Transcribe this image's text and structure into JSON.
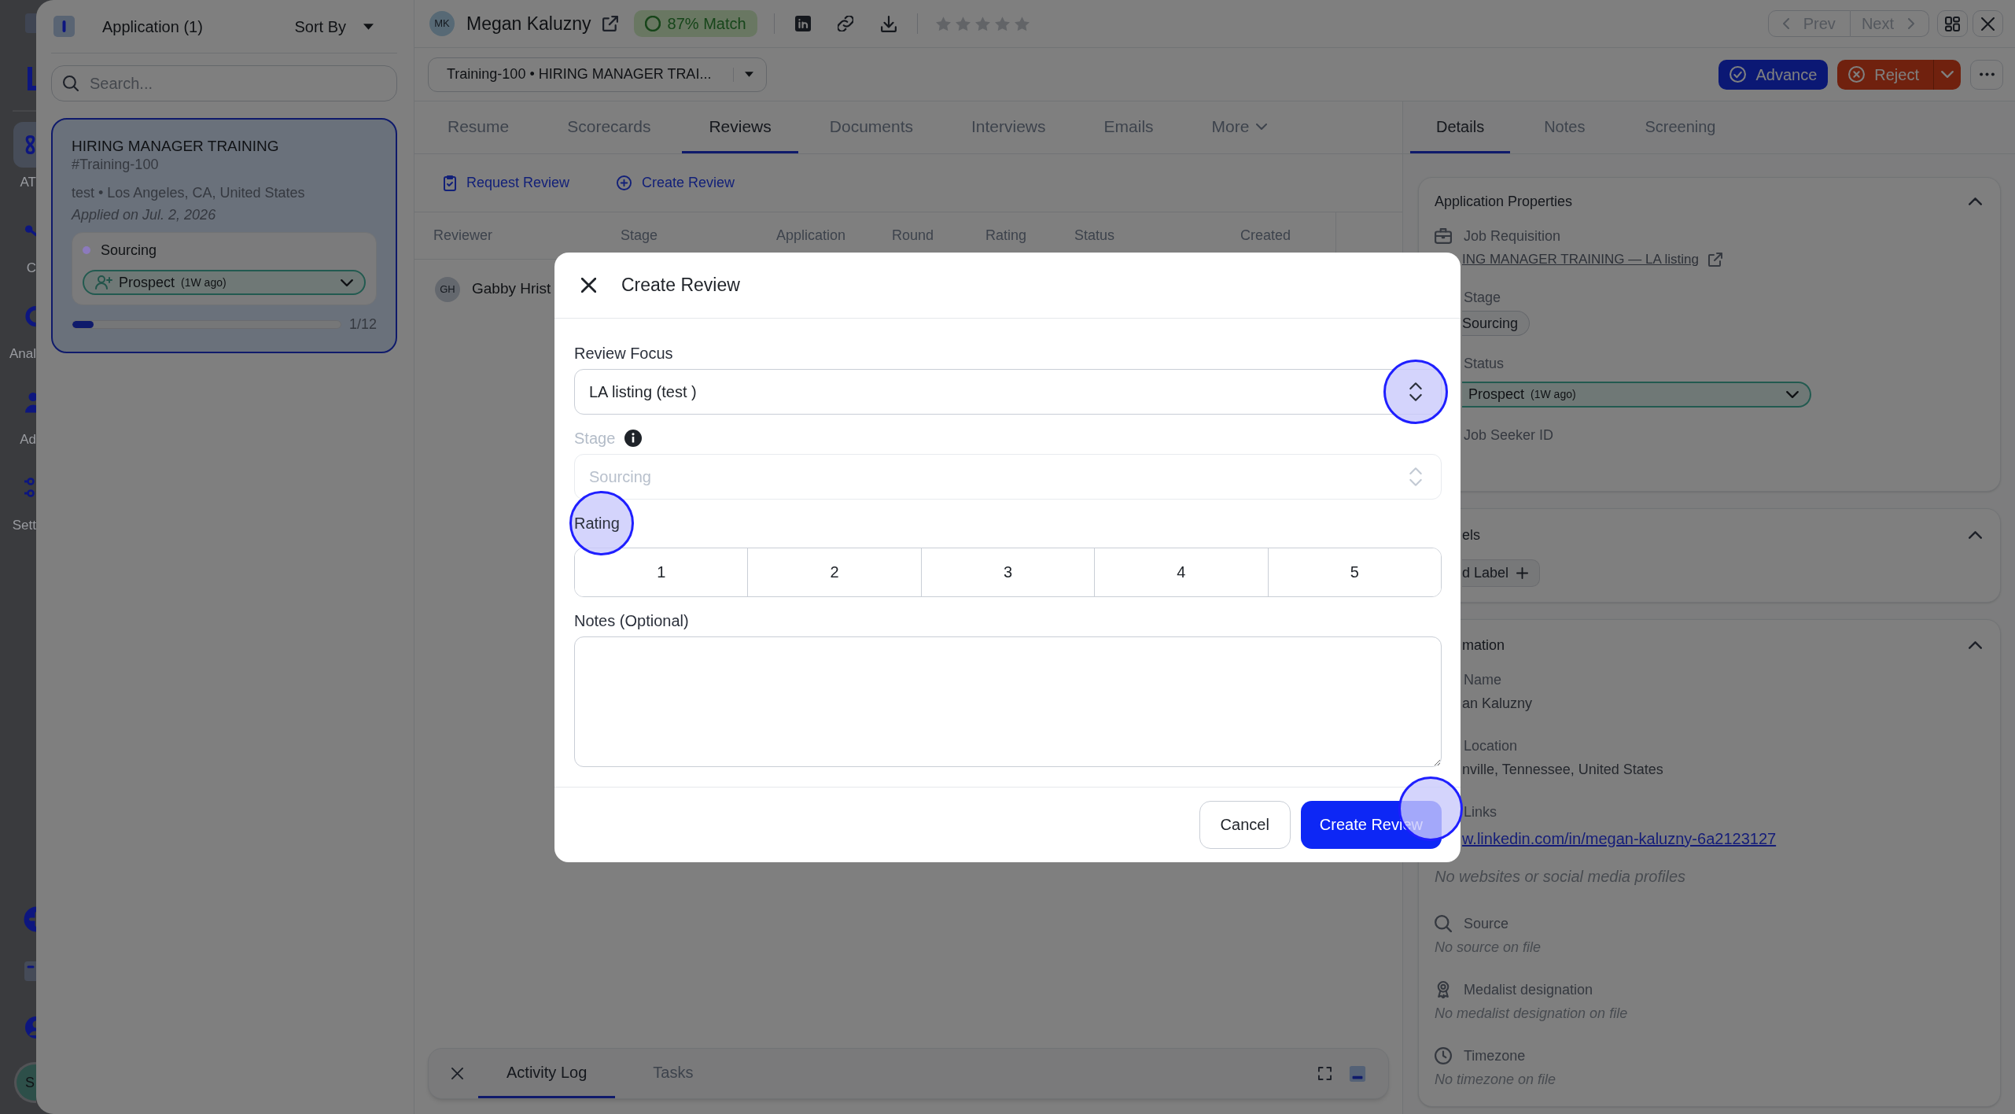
{
  "nav": {
    "items": [
      {
        "label": "AT",
        "selected": true
      },
      {
        "label": "C",
        "selected": false
      },
      {
        "label": "Anal",
        "selected": false
      },
      {
        "label": "Ad",
        "selected": false
      },
      {
        "label": "Sett",
        "selected": false
      }
    ],
    "avatar": "S"
  },
  "applications_panel": {
    "title": "Application (1)",
    "sort_label": "Sort By",
    "search": {
      "placeholder": "Search..."
    },
    "cards": [
      {
        "title": "HIRING MANAGER TRAINING",
        "code": "#Training-100",
        "location": "test • Los Angeles, CA, United States",
        "applied": "Applied on Jul. 2, 2026",
        "selected": true,
        "stage": {
          "label": "Sourcing",
          "color": "#8c7abd"
        },
        "status": {
          "label": "Prospect",
          "age": "(1W ago)"
        },
        "progress": {
          "level": 0.08,
          "label": "1/12"
        }
      }
    ]
  },
  "candidate": {
    "initials": "MK",
    "name": "Megan Kaluzny",
    "match": "87% Match",
    "stars": 0
  },
  "pager": {
    "prev": {
      "label": "Prev",
      "disabled": true
    },
    "next": {
      "label": "Next",
      "disabled": true
    }
  },
  "job_select": {
    "value": "Training-100 • HIRING MANAGER TRAI..."
  },
  "actions": [
    {
      "kind": "advance",
      "label": "Advance"
    },
    {
      "kind": "reject",
      "label": "Reject"
    }
  ],
  "tabs": [
    {
      "label": "Resume",
      "selected": false,
      "menu": false
    },
    {
      "label": "Scorecards",
      "selected": false,
      "menu": false
    },
    {
      "label": "Reviews",
      "selected": true,
      "menu": false
    },
    {
      "label": "Documents",
      "selected": false,
      "menu": false
    },
    {
      "label": "Interviews",
      "selected": false,
      "menu": false
    },
    {
      "label": "Emails",
      "selected": false,
      "menu": false
    },
    {
      "label": "More",
      "selected": false,
      "menu": true
    }
  ],
  "review_actions": [
    {
      "kind": "request",
      "label": "Request Review"
    },
    {
      "kind": "create",
      "label": "Create Review"
    }
  ],
  "reviews_table": {
    "columns": [
      "Reviewer",
      "Stage",
      "Application",
      "Round",
      "Rating",
      "Status",
      "Created"
    ],
    "rows": [
      {
        "initials": "GH",
        "reviewer": "Gabby Hrist"
      }
    ]
  },
  "activity_dock": {
    "tabs": [
      {
        "label": "Activity Log",
        "selected": true
      },
      {
        "label": "Tasks",
        "selected": false
      }
    ]
  },
  "detail_tabs": [
    {
      "label": "Details",
      "selected": true
    },
    {
      "label": "Notes",
      "selected": false
    },
    {
      "label": "Screening",
      "selected": false
    }
  ],
  "application_properties": {
    "title": "Application Properties",
    "expanded": true,
    "fields": [
      {
        "kind": "link",
        "label": "Job Requisition",
        "value": "ING MANAGER TRAINING — LA listing"
      },
      {
        "kind": "tag",
        "label": "Stage",
        "value": "Sourcing"
      },
      {
        "kind": "select",
        "label": "Status",
        "value": "Prospect",
        "age": "(1W ago)"
      },
      {
        "kind": "empty",
        "label": "Job Seeker ID"
      }
    ]
  },
  "labels_section": {
    "title": "els",
    "expanded": true,
    "add_button": "d Label"
  },
  "information": {
    "title": "mation",
    "expanded": true,
    "fields": [
      {
        "kind": "text",
        "label": "Name",
        "value": "an Kaluzny"
      },
      {
        "kind": "text",
        "label": "Location",
        "value": "nville, Tennessee, United States"
      },
      {
        "kind": "link",
        "label": "Links",
        "value": "w.linkedin.com/in/megan-kaluzny-6a2123127",
        "note": "No websites or social media profiles"
      },
      {
        "kind": "missing",
        "label": "Source",
        "value": "No source on file"
      },
      {
        "kind": "missing",
        "label": "Medalist designation",
        "value": "No medalist designation on file"
      },
      {
        "kind": "missing",
        "label": "Timezone",
        "value": "No timezone on file"
      }
    ]
  },
  "dialog": {
    "title": "Create Review",
    "fields": [
      {
        "kind": "select",
        "label": "Review Focus",
        "value": "LA listing (test )",
        "disabled": false,
        "info": false,
        "highlighted": true
      },
      {
        "kind": "select",
        "label": "Stage",
        "value": "Sourcing",
        "disabled": true,
        "info": true,
        "highlighted": false
      },
      {
        "kind": "rating",
        "label": "Rating",
        "options": [
          {
            "label": "1",
            "selected": false
          },
          {
            "label": "2",
            "selected": false
          },
          {
            "label": "3",
            "selected": false
          },
          {
            "label": "4",
            "selected": false
          },
          {
            "label": "5",
            "selected": false
          }
        ],
        "highlighted": true
      },
      {
        "kind": "textarea",
        "label": "Notes (Optional)",
        "highlighted": false
      }
    ],
    "buttons": [
      {
        "kind": "secondary",
        "label": "Cancel",
        "highlighted": false
      },
      {
        "kind": "primary",
        "label": "Create Review",
        "highlighted": true
      }
    ]
  }
}
